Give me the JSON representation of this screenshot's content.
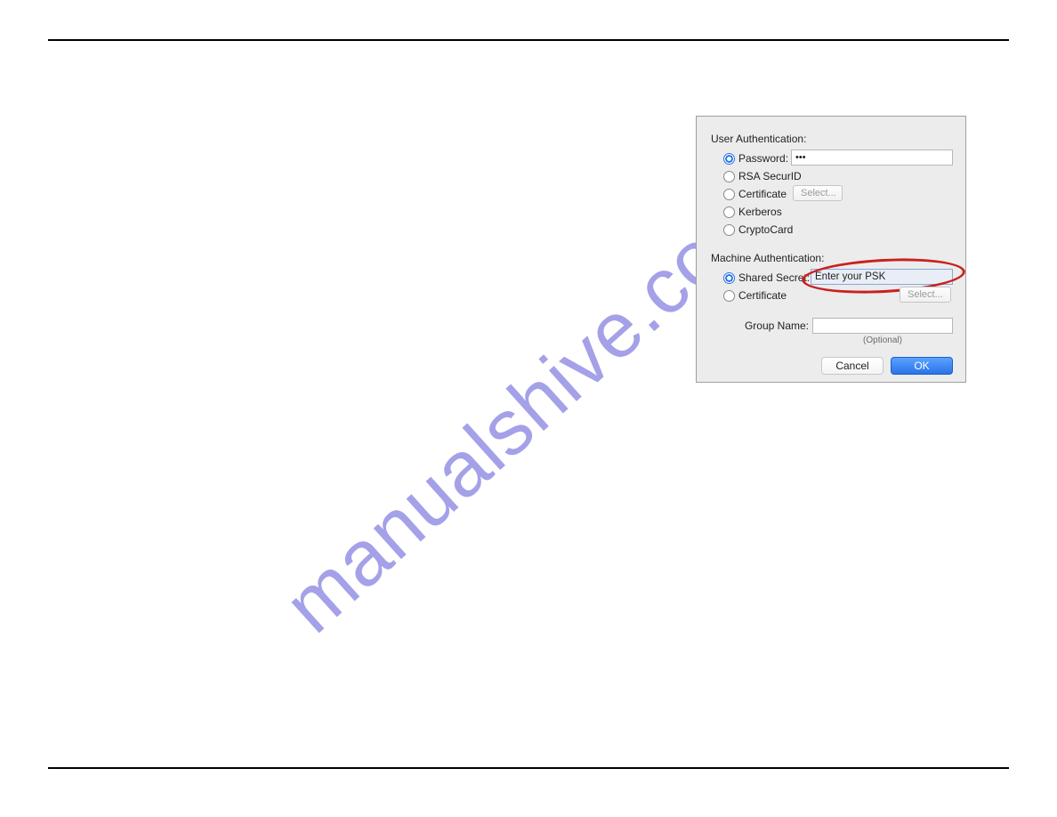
{
  "watermark": "manualshive.com",
  "dialog": {
    "user_auth": {
      "heading": "User Authentication:",
      "options": {
        "password": "Password:",
        "rsa": "RSA SecurID",
        "certificate": "Certificate",
        "kerberos": "Kerberos",
        "cryptocard": "CryptoCard"
      },
      "password_value": "•••",
      "select_label": "Select..."
    },
    "machine_auth": {
      "heading": "Machine Authentication:",
      "options": {
        "shared_secret": "Shared Secret:",
        "certificate": "Certificate"
      },
      "shared_secret_value": "Enter your PSK",
      "select_label": "Select..."
    },
    "group": {
      "label": "Group Name:",
      "value": "",
      "optional": "(Optional)"
    },
    "buttons": {
      "cancel": "Cancel",
      "ok": "OK"
    }
  }
}
